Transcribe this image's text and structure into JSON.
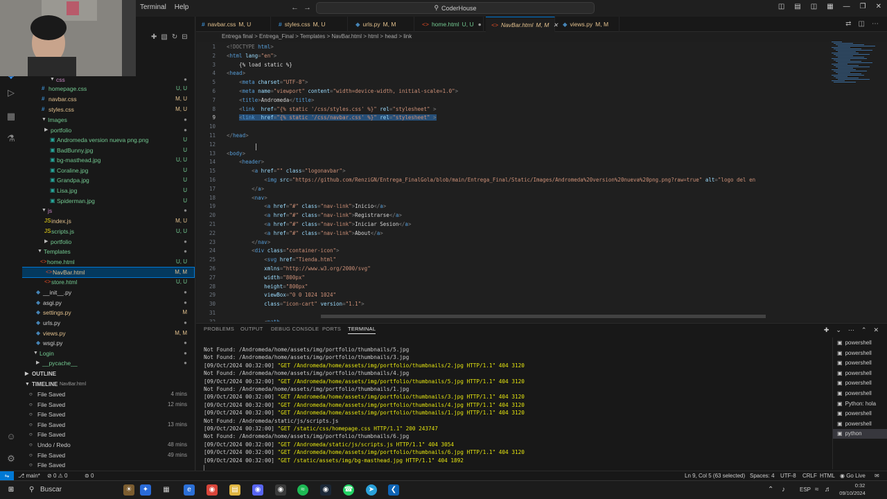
{
  "titlebar": {
    "menus": [
      "Terminal",
      "Help"
    ],
    "command_center": "CoderHouse"
  },
  "sidebar": {
    "tree": [
      {
        "name": "css",
        "type": "folder",
        "status": "",
        "color": "#c586c0"
      },
      {
        "name": "homepage.css",
        "type": "css",
        "status": "U, U",
        "color": "#73c991"
      },
      {
        "name": "navbar.css",
        "type": "css",
        "status": "M, U",
        "color": "#e2c08d"
      },
      {
        "name": "styles.css",
        "type": "css",
        "status": "M, U",
        "color": "#e2c08d"
      },
      {
        "name": "Images",
        "type": "folder",
        "status": "",
        "color": "#73c991"
      },
      {
        "name": "portfolio",
        "type": "folder",
        "status": "",
        "color": "#73c991"
      },
      {
        "name": "Andromeda version nueva png.png",
        "type": "img",
        "status": "U",
        "color": "#73c991"
      },
      {
        "name": "BadBunny.jpg",
        "type": "img",
        "status": "U",
        "color": "#73c991"
      },
      {
        "name": "bg-masthead.jpg",
        "type": "img",
        "status": "U, U",
        "color": "#73c991"
      },
      {
        "name": "Coraline.jpg",
        "type": "img",
        "status": "U",
        "color": "#73c991"
      },
      {
        "name": "Grandpa.jpg",
        "type": "img",
        "status": "U",
        "color": "#73c991"
      },
      {
        "name": "Lisa.jpg",
        "type": "img",
        "status": "U",
        "color": "#73c991"
      },
      {
        "name": "Spiderman.jpg",
        "type": "img",
        "status": "U",
        "color": "#73c991"
      },
      {
        "name": "js",
        "type": "folder",
        "status": "",
        "color": "#c586c0"
      },
      {
        "name": "index.js",
        "type": "js",
        "status": "M, U",
        "color": "#e2c08d"
      },
      {
        "name": "scripts.js",
        "type": "js",
        "status": "U, U",
        "color": "#73c991"
      },
      {
        "name": "portfolio",
        "type": "folder",
        "status": "",
        "color": "#73c991"
      },
      {
        "name": "Templates",
        "type": "folder",
        "status": "",
        "color": "#73c991"
      },
      {
        "name": "home.html",
        "type": "html",
        "status": "U, U",
        "color": "#73c991"
      },
      {
        "name": "NavBar.html",
        "type": "html",
        "status": "M, M",
        "color": "#e2c08d"
      },
      {
        "name": "store.html",
        "type": "html",
        "status": "U, U",
        "color": "#73c991"
      },
      {
        "name": "__init__.py",
        "type": "py",
        "status": "",
        "color": "#cccccc"
      },
      {
        "name": "asgi.py",
        "type": "py",
        "status": "",
        "color": "#cccccc"
      },
      {
        "name": "settings.py",
        "type": "py",
        "status": "M",
        "color": "#e2c08d"
      },
      {
        "name": "urls.py",
        "type": "py",
        "status": "",
        "color": "#cccccc"
      },
      {
        "name": "views.py",
        "type": "py",
        "status": "M, M",
        "color": "#e2c08d"
      },
      {
        "name": "wsgi.py",
        "type": "py",
        "status": "",
        "color": "#cccccc"
      },
      {
        "name": "Login",
        "type": "folder",
        "status": "",
        "color": "#73c991"
      },
      {
        "name": "__pycache__",
        "type": "folder",
        "status": "",
        "color": "#73c991"
      }
    ],
    "outline_label": "OUTLINE",
    "timeline_label": "TIMELINE",
    "timeline_file": "NavBar.html",
    "timeline": [
      {
        "label": "File Saved",
        "time": "4 mins"
      },
      {
        "label": "File Saved",
        "time": "12 mins"
      },
      {
        "label": "File Saved",
        "time": ""
      },
      {
        "label": "File Saved",
        "time": "13 mins"
      },
      {
        "label": "File Saved",
        "time": ""
      },
      {
        "label": "Undo / Redo",
        "time": "48 mins"
      },
      {
        "label": "File Saved",
        "time": "49 mins"
      },
      {
        "label": "File Saved",
        "time": ""
      }
    ]
  },
  "tabs": [
    {
      "name": "navbar.css",
      "status": "M, U"
    },
    {
      "name": "styles.css",
      "status": "M, U"
    },
    {
      "name": "urls.py",
      "status": "M, M"
    },
    {
      "name": "home.html",
      "status": "U, U"
    },
    {
      "name": "NavBar.html",
      "status": "M, M"
    },
    {
      "name": "views.py",
      "status": "M, M"
    }
  ],
  "breadcrumb": "Entrega final > Entrega_Final > Templates > NavBar.html > html > head > link",
  "code": [
    [
      [
        "punc",
        "<!DOCTYPE "
      ],
      [
        "tag",
        "html"
      ],
      [
        "punc",
        ">"
      ]
    ],
    [
      [
        "punc",
        "<"
      ],
      [
        "tag",
        "html"
      ],
      [
        "attr",
        " lang"
      ],
      [
        "punc",
        "="
      ],
      [
        "str",
        "\"en\""
      ],
      [
        "punc",
        ">"
      ]
    ],
    [
      [
        "txt",
        "    {% load static %}"
      ]
    ],
    [
      [
        "punc",
        "<"
      ],
      [
        "tag",
        "head"
      ],
      [
        "punc",
        ">"
      ]
    ],
    [
      [
        "txt",
        "    "
      ],
      [
        "punc",
        "<"
      ],
      [
        "tag",
        "meta"
      ],
      [
        "attr",
        " charset"
      ],
      [
        "punc",
        "="
      ],
      [
        "str",
        "\"UTF-8\""
      ],
      [
        "punc",
        ">"
      ]
    ],
    [
      [
        "txt",
        "    "
      ],
      [
        "punc",
        "<"
      ],
      [
        "tag",
        "meta"
      ],
      [
        "attr",
        " name"
      ],
      [
        "punc",
        "="
      ],
      [
        "str",
        "\"viewport\""
      ],
      [
        "attr",
        " content"
      ],
      [
        "punc",
        "="
      ],
      [
        "str",
        "\"width=device-width, initial-scale=1.0\""
      ],
      [
        "punc",
        ">"
      ]
    ],
    [
      [
        "txt",
        "    "
      ],
      [
        "punc",
        "<"
      ],
      [
        "tag",
        "title"
      ],
      [
        "punc",
        ">"
      ],
      [
        "txt",
        "Andromeda"
      ],
      [
        "punc",
        "</"
      ],
      [
        "tag",
        "title"
      ],
      [
        "punc",
        ">"
      ]
    ],
    [
      [
        "txt",
        "    "
      ],
      [
        "punc",
        "<"
      ],
      [
        "tag",
        "link"
      ],
      [
        "attr",
        "  href"
      ],
      [
        "punc",
        "="
      ],
      [
        "str",
        "\"{% static '/css/styles.css' %}\""
      ],
      [
        "attr",
        " rel"
      ],
      [
        "punc",
        "="
      ],
      [
        "str",
        "\"stylesheet\""
      ],
      [
        "punc",
        " >"
      ]
    ],
    [
      [
        "txt",
        "    "
      ],
      [
        "punc",
        "<"
      ],
      [
        "tag",
        "link"
      ],
      [
        "attr",
        "  href"
      ],
      [
        "punc",
        "="
      ],
      [
        "str",
        "\"{% static '/css/navbar.css' %}\""
      ],
      [
        "attr",
        " rel"
      ],
      [
        "punc",
        "="
      ],
      [
        "str",
        "\"stylesheet\""
      ],
      [
        "punc",
        " >"
      ]
    ],
    [],
    [
      [
        "punc",
        "</"
      ],
      [
        "tag",
        "head"
      ],
      [
        "punc",
        ">"
      ]
    ],
    [],
    [
      [
        "punc",
        "<"
      ],
      [
        "tag",
        "body"
      ],
      [
        "punc",
        ">"
      ]
    ],
    [
      [
        "txt",
        "    "
      ],
      [
        "punc",
        "<"
      ],
      [
        "tag",
        "header"
      ],
      [
        "punc",
        ">"
      ]
    ],
    [
      [
        "txt",
        "        "
      ],
      [
        "punc",
        "<"
      ],
      [
        "tag",
        "a"
      ],
      [
        "attr",
        " href"
      ],
      [
        "punc",
        "="
      ],
      [
        "str",
        "\"\""
      ],
      [
        "attr",
        " class"
      ],
      [
        "punc",
        "="
      ],
      [
        "str",
        "\"logonavbar\""
      ],
      [
        "punc",
        ">"
      ]
    ],
    [
      [
        "txt",
        "            "
      ],
      [
        "punc",
        "<"
      ],
      [
        "tag",
        "img"
      ],
      [
        "attr",
        " src"
      ],
      [
        "punc",
        "="
      ],
      [
        "str",
        "\"https://github.com/RenziGN/Entrega_FinalGola/blob/main/Entrega_Final/Static/Images/Andromeda%20version%20nueva%20png.png?raw=true\""
      ],
      [
        "attr",
        " alt"
      ],
      [
        "punc",
        "="
      ],
      [
        "str",
        "\"logo del en"
      ]
    ],
    [
      [
        "txt",
        "        "
      ],
      [
        "punc",
        "</"
      ],
      [
        "tag",
        "a"
      ],
      [
        "punc",
        ">"
      ]
    ],
    [
      [
        "txt",
        "        "
      ],
      [
        "punc",
        "<"
      ],
      [
        "tag",
        "nav"
      ],
      [
        "punc",
        ">"
      ]
    ],
    [
      [
        "txt",
        "            "
      ],
      [
        "punc",
        "<"
      ],
      [
        "tag",
        "a"
      ],
      [
        "attr",
        " href"
      ],
      [
        "punc",
        "="
      ],
      [
        "str",
        "\"#\""
      ],
      [
        "attr",
        " class"
      ],
      [
        "punc",
        "="
      ],
      [
        "str",
        "\"nav-link\""
      ],
      [
        "punc",
        ">"
      ],
      [
        "txt",
        "Inicio"
      ],
      [
        "punc",
        "</"
      ],
      [
        "tag",
        "a"
      ],
      [
        "punc",
        ">"
      ]
    ],
    [
      [
        "txt",
        "            "
      ],
      [
        "punc",
        "<"
      ],
      [
        "tag",
        "a"
      ],
      [
        "attr",
        " href"
      ],
      [
        "punc",
        "="
      ],
      [
        "str",
        "\"#\""
      ],
      [
        "attr",
        " class"
      ],
      [
        "punc",
        "="
      ],
      [
        "str",
        "\"nav-link\""
      ],
      [
        "punc",
        ">"
      ],
      [
        "txt",
        "Registrarse"
      ],
      [
        "punc",
        "</"
      ],
      [
        "tag",
        "a"
      ],
      [
        "punc",
        ">"
      ]
    ],
    [
      [
        "txt",
        "            "
      ],
      [
        "punc",
        "<"
      ],
      [
        "tag",
        "a"
      ],
      [
        "attr",
        " href"
      ],
      [
        "punc",
        "="
      ],
      [
        "str",
        "\"#\""
      ],
      [
        "attr",
        " class"
      ],
      [
        "punc",
        "="
      ],
      [
        "str",
        "\"nav-link\""
      ],
      [
        "punc",
        ">"
      ],
      [
        "txt",
        "Iniciar Sesion"
      ],
      [
        "punc",
        "</"
      ],
      [
        "tag",
        "a"
      ],
      [
        "punc",
        ">"
      ]
    ],
    [
      [
        "txt",
        "            "
      ],
      [
        "punc",
        "<"
      ],
      [
        "tag",
        "a"
      ],
      [
        "attr",
        " href"
      ],
      [
        "punc",
        "="
      ],
      [
        "str",
        "\"#\""
      ],
      [
        "attr",
        " class"
      ],
      [
        "punc",
        "="
      ],
      [
        "str",
        "\"nav-link\""
      ],
      [
        "punc",
        ">"
      ],
      [
        "txt",
        "About"
      ],
      [
        "punc",
        "</"
      ],
      [
        "tag",
        "a"
      ],
      [
        "punc",
        ">"
      ]
    ],
    [
      [
        "txt",
        "        "
      ],
      [
        "punc",
        "</"
      ],
      [
        "tag",
        "nav"
      ],
      [
        "punc",
        ">"
      ]
    ],
    [
      [
        "txt",
        "        "
      ],
      [
        "punc",
        "<"
      ],
      [
        "tag",
        "div"
      ],
      [
        "attr",
        " class"
      ],
      [
        "punc",
        "="
      ],
      [
        "str",
        "\"container-icon\""
      ],
      [
        "punc",
        ">"
      ]
    ],
    [
      [
        "txt",
        "            "
      ],
      [
        "punc",
        "<"
      ],
      [
        "tag",
        "svg"
      ],
      [
        "attr",
        " href"
      ],
      [
        "punc",
        "="
      ],
      [
        "str",
        "\"Tienda.html\""
      ]
    ],
    [
      [
        "attr",
        "            xmlns"
      ],
      [
        "punc",
        "="
      ],
      [
        "str",
        "\"http://www.w3.org/2000/svg\""
      ]
    ],
    [
      [
        "attr",
        "            width"
      ],
      [
        "punc",
        "="
      ],
      [
        "str",
        "\"800px\""
      ]
    ],
    [
      [
        "attr",
        "            height"
      ],
      [
        "punc",
        "="
      ],
      [
        "str",
        "\"800px\""
      ]
    ],
    [
      [
        "attr",
        "            viewBox"
      ],
      [
        "punc",
        "="
      ],
      [
        "str",
        "\"0 0 1024 1024\""
      ]
    ],
    [
      [
        "attr",
        "            class"
      ],
      [
        "punc",
        "="
      ],
      [
        "str",
        "\"icon-cart\""
      ],
      [
        "attr",
        " version"
      ],
      [
        "punc",
        "="
      ],
      [
        "str",
        "\"1.1\""
      ],
      [
        "punc",
        ">"
      ]
    ],
    [],
    [
      [
        "txt",
        "            "
      ],
      [
        "punc",
        "<"
      ],
      [
        "tag",
        "path"
      ]
    ]
  ],
  "panel": {
    "tabs": [
      "PROBLEMS",
      "OUTPUT",
      "DEBUG CONSOLE",
      "PORTS",
      "TERMINAL"
    ],
    "terminal_lines": [
      [
        "Not Found: /Andromeda/home/assets/img/portfolio/thumbnails/5.jpg",
        ""
      ],
      [
        "Not Found: /Andromeda/home/assets/img/portfolio/thumbnails/3.jpg",
        ""
      ],
      [
        "[09/Oct/2024 00:32:00] ",
        "\"GET /Andromeda/home/assets/img/portfolio/thumbnails/2.jpg HTTP/1.1\" 404 3120"
      ],
      [
        "Not Found: /Andromeda/home/assets/img/portfolio/thumbnails/4.jpg",
        ""
      ],
      [
        "[09/Oct/2024 00:32:00] ",
        "\"GET /Andromeda/home/assets/img/portfolio/thumbnails/5.jpg HTTP/1.1\" 404 3120"
      ],
      [
        "Not Found: /Andromeda/home/assets/img/portfolio/thumbnails/1.jpg",
        ""
      ],
      [
        "[09/Oct/2024 00:32:00] ",
        "\"GET /Andromeda/home/assets/img/portfolio/thumbnails/3.jpg HTTP/1.1\" 404 3120"
      ],
      [
        "[09/Oct/2024 00:32:00] ",
        "\"GET /Andromeda/home/assets/img/portfolio/thumbnails/4.jpg HTTP/1.1\" 404 3120"
      ],
      [
        "[09/Oct/2024 00:32:00] ",
        "\"GET /Andromeda/home/assets/img/portfolio/thumbnails/1.jpg HTTP/1.1\" 404 3120"
      ],
      [
        "Not Found: /Andromeda/static/js/scripts.js",
        ""
      ],
      [
        "[09/Oct/2024 00:32:00] ",
        "\"GET /static/css/homepage.css HTTP/1.1\" 200 243747"
      ],
      [
        "Not Found: /Andromeda/home/assets/img/portfolio/thumbnails/6.jpg",
        ""
      ],
      [
        "[09/Oct/2024 00:32:00] ",
        "\"GET /Andromeda/static/js/scripts.js HTTP/1.1\" 404 3054"
      ],
      [
        "[09/Oct/2024 00:32:00] ",
        "\"GET /Andromeda/home/assets/img/portfolio/thumbnails/6.jpg HTTP/1.1\" 404 3120"
      ],
      [
        "[09/Oct/2024 00:32:00] ",
        "\"GET /static/assets/img/bg-masthead.jpg HTTP/1.1\" 404 1892"
      ]
    ],
    "terminals": [
      "powershell",
      "powershell",
      "powershell",
      "powershell",
      "powershell",
      "powershell",
      "Python: hola",
      "powershell",
      "powershell",
      "python"
    ]
  },
  "status": {
    "branch": "main*",
    "errors": "0",
    "warnings": "0",
    "ports": "0",
    "position": "Ln 9, Col 5 (63 selected)",
    "spaces": "Spaces: 4",
    "encoding": "UTF-8",
    "eol": "CRLF",
    "language": "HTML",
    "golive": "Go Live"
  },
  "taskbar": {
    "search": "Buscar",
    "lang": "ESP",
    "time": "0:32",
    "date": "09/10/2024"
  }
}
